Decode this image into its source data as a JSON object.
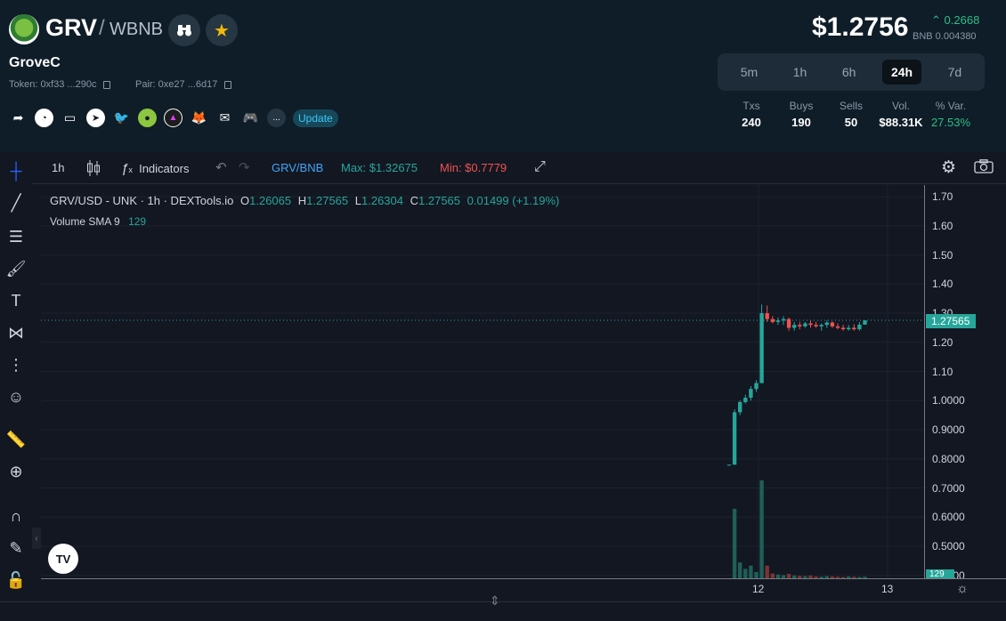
{
  "header": {
    "symbol": "GRV",
    "slash": "/",
    "quote": "WBNB",
    "name": "GroveC",
    "token_label": "Token: 0xf33 ...290c",
    "pair_label": "Pair: 0xe27 ...6d17",
    "update_label": "Update",
    "more_label": "...",
    "price": "$1.2756",
    "change": "0.2668",
    "bnb_price": "BNB 0.004380"
  },
  "timeframes": [
    {
      "label": "5m",
      "active": false
    },
    {
      "label": "1h",
      "active": false
    },
    {
      "label": "6h",
      "active": false
    },
    {
      "label": "24h",
      "active": true
    },
    {
      "label": "7d",
      "active": false
    }
  ],
  "stats": [
    {
      "label": "Txs",
      "value": "240"
    },
    {
      "label": "Buys",
      "value": "190"
    },
    {
      "label": "Sells",
      "value": "50"
    },
    {
      "label": "Vol.",
      "value": "$88.31K"
    },
    {
      "label": "% Var.",
      "value": "27.53%"
    }
  ],
  "toolbar": {
    "interval": "1h",
    "indicators": "Indicators",
    "pair_toggle": "GRV/BNB",
    "max": "Max: $1.32675",
    "min": "Min: $0.7779"
  },
  "legend": {
    "title": "GRV/USD - UNK · 1h · DEXTools.io",
    "o_label": "O",
    "o": "1.26065",
    "h_label": "H",
    "h": "1.27565",
    "l_label": "L",
    "l": "1.26304",
    "c_label": "C",
    "c": "1.27565",
    "change": "0.01499 (+1.19%)",
    "volume_label": "Volume SMA 9",
    "volume_value": "129"
  },
  "axis": {
    "price_label": "1.27565",
    "volume_label": "129",
    "y_ticks": [
      "1.70",
      "1.60",
      "1.50",
      "1.40",
      "1.30",
      "1.20",
      "1.10",
      "1.0000",
      "0.9000",
      "0.8000",
      "0.7000",
      "0.6000",
      "0.5000",
      "0.4000"
    ],
    "x_ticks": [
      "12",
      "13"
    ]
  },
  "colors": {
    "up": "#26a69a",
    "down": "#ef5350",
    "accent": "#2ebd85"
  },
  "chart_data": {
    "type": "candlestick",
    "title": "GRV/USD - UNK · 1h · DEXTools.io",
    "ylim": [
      0.39,
      1.74
    ],
    "y_ticks": [
      1.7,
      1.6,
      1.5,
      1.4,
      1.3,
      1.2,
      1.1,
      1.0,
      0.9,
      0.8,
      0.7,
      0.6,
      0.5,
      0.4
    ],
    "last_price": 1.27565,
    "candles": [
      {
        "o": 0.78,
        "h": 0.78,
        "l": 0.7779,
        "c": 0.78,
        "v": 0
      },
      {
        "o": 0.78,
        "h": 0.97,
        "l": 0.78,
        "c": 0.96,
        "v": 220
      },
      {
        "o": 0.96,
        "h": 1.0,
        "l": 0.95,
        "c": 0.995,
        "v": 50
      },
      {
        "o": 0.995,
        "h": 1.02,
        "l": 0.99,
        "c": 1.01,
        "v": 30
      },
      {
        "o": 1.01,
        "h": 1.05,
        "l": 1.0,
        "c": 1.04,
        "v": 40
      },
      {
        "o": 1.04,
        "h": 1.07,
        "l": 1.03,
        "c": 1.06,
        "v": 20
      },
      {
        "o": 1.06,
        "h": 1.33,
        "l": 1.06,
        "c": 1.3,
        "v": 310
      },
      {
        "o": 1.3,
        "h": 1.32675,
        "l": 1.27,
        "c": 1.28,
        "v": 40
      },
      {
        "o": 1.28,
        "h": 1.29,
        "l": 1.265,
        "c": 1.27,
        "v": 15
      },
      {
        "o": 1.27,
        "h": 1.285,
        "l": 1.26,
        "c": 1.275,
        "v": 12
      },
      {
        "o": 1.275,
        "h": 1.29,
        "l": 1.26,
        "c": 1.28,
        "v": 10
      },
      {
        "o": 1.28,
        "h": 1.285,
        "l": 1.24,
        "c": 1.25,
        "v": 14
      },
      {
        "o": 1.25,
        "h": 1.27,
        "l": 1.24,
        "c": 1.26,
        "v": 9
      },
      {
        "o": 1.26,
        "h": 1.27,
        "l": 1.245,
        "c": 1.255,
        "v": 8
      },
      {
        "o": 1.255,
        "h": 1.27,
        "l": 1.25,
        "c": 1.265,
        "v": 7
      },
      {
        "o": 1.265,
        "h": 1.275,
        "l": 1.25,
        "c": 1.26,
        "v": 9
      },
      {
        "o": 1.26,
        "h": 1.27,
        "l": 1.25,
        "c": 1.255,
        "v": 6
      },
      {
        "o": 1.255,
        "h": 1.265,
        "l": 1.24,
        "c": 1.26,
        "v": 5
      },
      {
        "o": 1.26,
        "h": 1.275,
        "l": 1.25,
        "c": 1.268,
        "v": 7
      },
      {
        "o": 1.268,
        "h": 1.272,
        "l": 1.25,
        "c": 1.255,
        "v": 6
      },
      {
        "o": 1.255,
        "h": 1.265,
        "l": 1.245,
        "c": 1.25,
        "v": 5
      },
      {
        "o": 1.25,
        "h": 1.26,
        "l": 1.24,
        "c": 1.245,
        "v": 4
      },
      {
        "o": 1.245,
        "h": 1.26,
        "l": 1.24,
        "c": 1.25,
        "v": 6
      },
      {
        "o": 1.25,
        "h": 1.262,
        "l": 1.24,
        "c": 1.245,
        "v": 5
      },
      {
        "o": 1.245,
        "h": 1.27,
        "l": 1.24,
        "c": 1.26065,
        "v": 4
      },
      {
        "o": 1.26065,
        "h": 1.27565,
        "l": 1.26304,
        "c": 1.27565,
        "v": 5
      }
    ]
  }
}
